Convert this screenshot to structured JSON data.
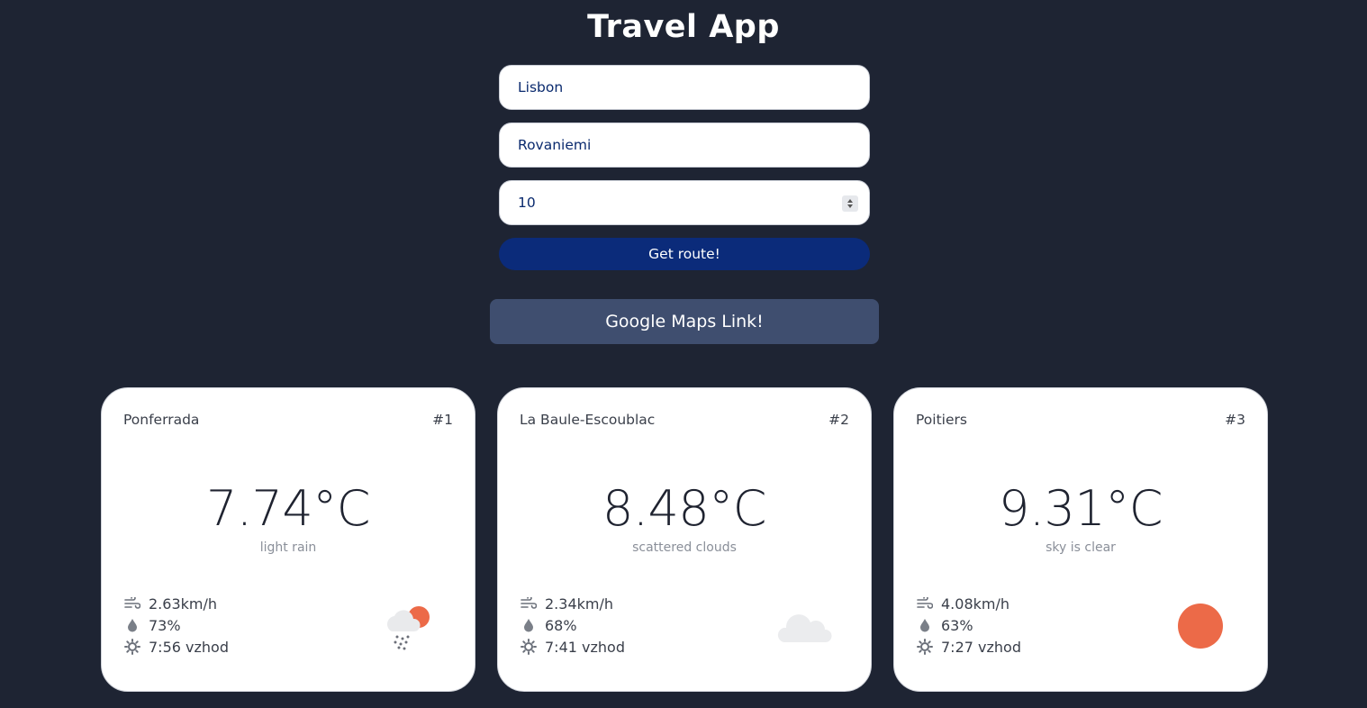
{
  "app": {
    "title": "Travel App"
  },
  "form": {
    "origin_value": "Lisbon",
    "destination_value": "Rovaniemi",
    "stops_value": "10",
    "submit_label": "Get route!"
  },
  "maps_button": {
    "label": "Google Maps Link!"
  },
  "colors": {
    "background": "#1e2433",
    "route_button": "#0b2b7a",
    "maps_button": "#3f4e6f",
    "sun": "#ec6a48"
  },
  "cards": [
    {
      "city": "Ponferrada",
      "rank": "#1",
      "temp": "7.74°C",
      "desc": "light rain",
      "wind": "2.63km/h",
      "humidity": "73%",
      "sunrise": "7:56 vzhod",
      "icon": "cloud-sun-snow-icon"
    },
    {
      "city": "La Baule-Escoublac",
      "rank": "#2",
      "temp": "8.48°C",
      "desc": "scattered clouds",
      "wind": "2.34km/h",
      "humidity": "68%",
      "sunrise": "7:41 vzhod",
      "icon": "cloud-icon"
    },
    {
      "city": "Poitiers",
      "rank": "#3",
      "temp": "9.31°C",
      "desc": "sky is clear",
      "wind": "4.08km/h",
      "humidity": "63%",
      "sunrise": "7:27 vzhod",
      "icon": "sun-icon"
    }
  ]
}
